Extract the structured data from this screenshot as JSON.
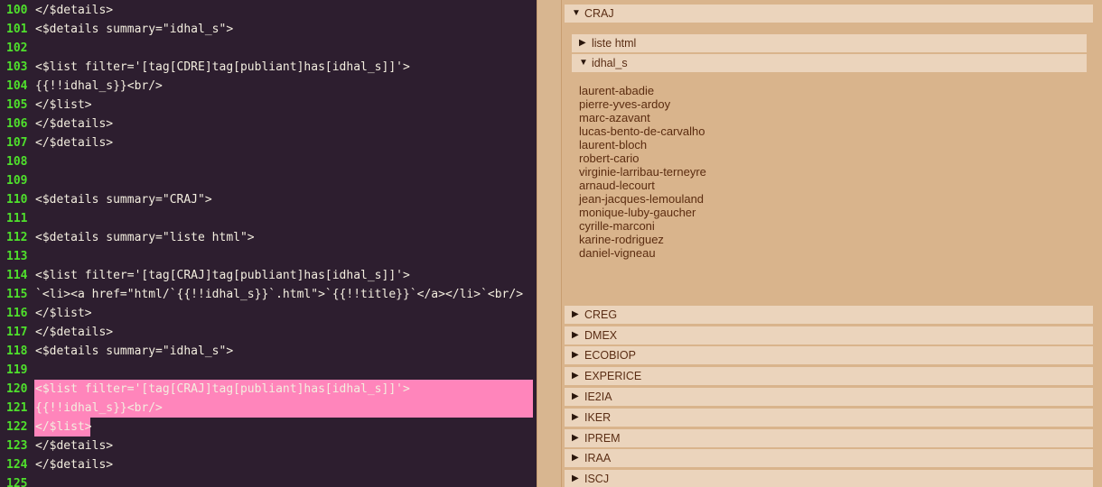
{
  "editor": {
    "lines": [
      {
        "num": "100",
        "code": "</$details>"
      },
      {
        "num": "101",
        "code": "<$details summary=\"idhal_s\">"
      },
      {
        "num": "102",
        "code": ""
      },
      {
        "num": "103",
        "code": "<$list filter='[tag[CDRE]tag[publiant]has[idhal_s]]'>"
      },
      {
        "num": "104",
        "code": "{{!!idhal_s}}<br/>"
      },
      {
        "num": "105",
        "code": "</$list>"
      },
      {
        "num": "106",
        "code": "</$details>"
      },
      {
        "num": "107",
        "code": "</$details>"
      },
      {
        "num": "108",
        "code": ""
      },
      {
        "num": "109",
        "code": ""
      },
      {
        "num": "110",
        "code": "<$details summary=\"CRAJ\">"
      },
      {
        "num": "111",
        "code": ""
      },
      {
        "num": "112",
        "code": "<$details summary=\"liste html\">"
      },
      {
        "num": "113",
        "code": ""
      },
      {
        "num": "114",
        "code": "<$list filter='[tag[CRAJ]tag[publiant]has[idhal_s]]'>"
      },
      {
        "num": "115",
        "code": "`<li><a href=\"html/`{{!!idhal_s}}`.html\">`{{!!title}}`</a></li>`<br/>"
      },
      {
        "num": "116",
        "code": "</$list>"
      },
      {
        "num": "117",
        "code": "</$details>"
      },
      {
        "num": "118",
        "code": "<$details summary=\"idhal_s\">"
      },
      {
        "num": "119",
        "code": ""
      },
      {
        "num": "120",
        "code": "<$list filter='[tag[CRAJ]tag[publiant]has[idhal_s]]'>"
      },
      {
        "num": "121",
        "code": "{{!!idhal_s}}<br/>"
      },
      {
        "num": "122",
        "code": "</$list>"
      },
      {
        "num": "123",
        "code": "</$details>"
      },
      {
        "num": "124",
        "code": "</$details>"
      },
      {
        "num": "125",
        "code": ""
      }
    ]
  },
  "preview": {
    "craj": {
      "arrow": "▼",
      "label": "CRAJ"
    },
    "liste_html": {
      "arrow": "▶",
      "label": "liste html"
    },
    "idhal_s": {
      "arrow": "▼",
      "label": "idhal_s"
    },
    "names": [
      "laurent-abadie",
      "pierre-yves-ardoy",
      "marc-azavant",
      "lucas-bento-de-carvalho",
      "laurent-bloch",
      "robert-cario",
      "virginie-larribau-terneyre",
      "arnaud-lecourt",
      "jean-jacques-lemouland",
      "monique-luby-gaucher",
      "cyrille-marconi",
      "karine-rodriguez",
      "daniel-vigneau"
    ],
    "groups": [
      {
        "arrow": "▶",
        "label": "CREG"
      },
      {
        "arrow": "▶",
        "label": "DMEX"
      },
      {
        "arrow": "▶",
        "label": "ECOBIOP"
      },
      {
        "arrow": "▶",
        "label": "EXPERICE"
      },
      {
        "arrow": "▶",
        "label": "IE2IA"
      },
      {
        "arrow": "▶",
        "label": "IKER"
      },
      {
        "arrow": "▶",
        "label": "IPREM"
      },
      {
        "arrow": "▶",
        "label": "IRAA"
      },
      {
        "arrow": "▶",
        "label": "ISCJ"
      }
    ]
  }
}
